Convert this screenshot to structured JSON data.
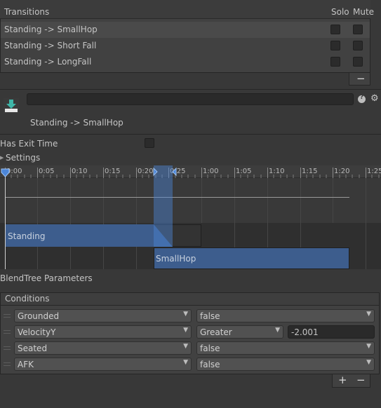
{
  "transitions": {
    "header_label": "Transitions",
    "solo_label": "Solo",
    "mute_label": "Mute",
    "items": [
      {
        "label": "Standing -> SmallHop",
        "solo": false,
        "mute": false,
        "selected": true
      },
      {
        "label": "Standing -> Short Fall",
        "solo": false,
        "mute": false,
        "selected": false
      },
      {
        "label": "Standing -> LongFall",
        "solo": false,
        "mute": false,
        "selected": false
      }
    ],
    "remove_label": "−"
  },
  "transition": {
    "name_value": "",
    "title": "Standing -> SmallHop",
    "help_icon": "help-icon",
    "settings_icon": "gear-icon",
    "has_exit_time_label": "Has Exit Time",
    "has_exit_time": false,
    "settings_label": "Settings"
  },
  "timeline": {
    "ruler_labels": [
      "0:00",
      "0:05",
      "0:10",
      "0:15",
      "0:20",
      "0:25",
      "1:00",
      "1:05",
      "1:10",
      "1:15",
      "1:20",
      "1:25"
    ],
    "source_state": "Standing",
    "dest_state": "SmallHop"
  },
  "blendtree_label": "BlendTree Parameters",
  "conditions": {
    "header_label": "Conditions",
    "items": [
      {
        "parameter": "Grounded",
        "mode": "false",
        "value": null
      },
      {
        "parameter": "VelocityY",
        "mode": "Greater",
        "value": "-2.001"
      },
      {
        "parameter": "Seated",
        "mode": "false",
        "value": null
      },
      {
        "parameter": "AFK",
        "mode": "false",
        "value": null
      }
    ],
    "add_label": "+",
    "remove_label": "−"
  },
  "colors": {
    "background": "#383838",
    "panel": "#414141",
    "selected_row": "#4a4a4a",
    "timeline_blue": "#3d5d8d",
    "marker_blue": "#4c86d8"
  }
}
